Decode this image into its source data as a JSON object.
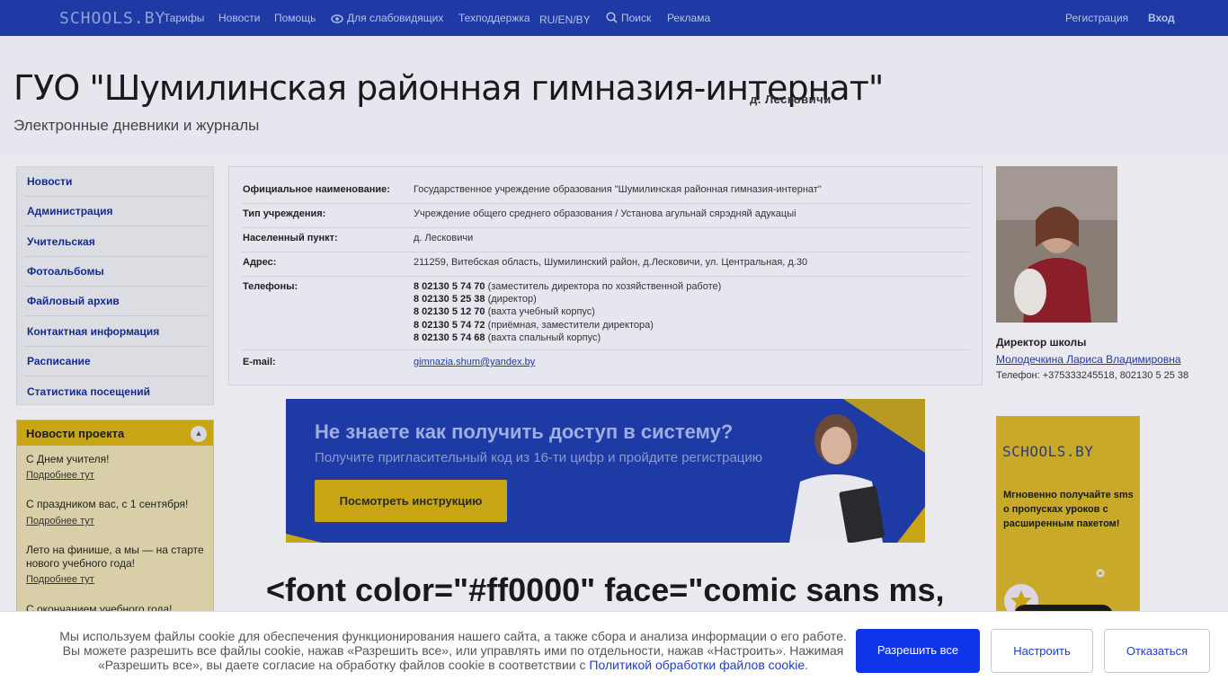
{
  "topbar": {
    "logo": "SCHOOLS.BY",
    "nav": [
      "Тарифы",
      "Новости",
      "Помощь",
      "Для слабовидящих",
      "Техподдержка",
      "RU/EN/BY",
      "Поиск",
      "Реклама"
    ],
    "register": "Регистрация",
    "login": "Вход"
  },
  "header": {
    "title": "ГУО \"Шумилинская районная гимназия-интернат\"",
    "location": "д. Лесковичи",
    "subtitle": "Электронные дневники и журналы"
  },
  "menu": [
    "Новости",
    "Администрация",
    "Учительская",
    "Фотоальбомы",
    "Файловый архив",
    "Контактная информация",
    "Расписание",
    "Статистика посещений"
  ],
  "project_news": {
    "title": "Новости проекта",
    "items": [
      {
        "title": "С Днем учителя!",
        "link": "Подробнее тут"
      },
      {
        "title": "С праздником вас, с 1 сентября!",
        "link": "Подробнее тут"
      },
      {
        "title": "Лето на финише, а мы — на старте нового учебного года!",
        "link": "Подробнее тут"
      },
      {
        "title": "С окончанием учебного года!",
        "link": ""
      }
    ]
  },
  "info": {
    "official_name_label": "Официальное наименование:",
    "official_name": "Государственное учреждение образования \"Шумилинская районная гимназия-интернат\"",
    "type_label": "Тип учреждения:",
    "type": "Учреждение общего среднего образования / Установа агульнай сярэдняй адукацыі",
    "locality_label": "Населенный пункт:",
    "locality": "д. Лесковичи",
    "address_label": "Адрес:",
    "address": "211259, Витебская область, Шумилинский район, д.Лесковичи, ул. Центральная, д.30",
    "phones_label": "Телефоны:",
    "phones": [
      {
        "number": "8 02130 5 74 70",
        "note": "(заместитель директора по хозяйственной работе)"
      },
      {
        "number": "8 02130 5 25 38",
        "note": "(директор)"
      },
      {
        "number": "8 02130 5 12 70",
        "note": "(вахта учебный корпус)"
      },
      {
        "number": "8 02130 5 74 72",
        "note": "(приёмная, заместители директора)"
      },
      {
        "number": "8 02130 5 74 68",
        "note": "(вахта спальный корпус)"
      }
    ],
    "email_label": "E-mail:",
    "email": "gimnazia.shum@yandex.by"
  },
  "director": {
    "title": "Директор школы",
    "name": "Молодечкина Лариса Владимировна",
    "phone": "Телефон: +375333245518, 802130 5 25 38"
  },
  "banner": {
    "title": "Не знаете как получить доступ в систему?",
    "subtitle": "Получите пригласительный код из 16-ти цифр и пройдите регистрацию",
    "button": "Посмотреть инструкцию"
  },
  "ad": {
    "logo": "SCHOOLS.BY",
    "text": "Мгновенно получайте sms о пропусках уроков с расширенным пакетом!"
  },
  "main_heading": "<font color=\"#ff0000\" face=\"comic sans ms,",
  "cookie": {
    "text": "Мы используем файлы cookie для обеспечения функционирования нашего сайта, а также сбора и анализа информации о его работе. Вы можете разрешить все файлы cookie, нажав «Разрешить все», или управлять ими по отдельности, нажав «Настроить». Нажимая «Разрешить все», вы даете согласие на обработку файлов cookie в соответствии с",
    "link": "Политикой обработки файлов cookie",
    "tail": ".",
    "accept": "Разрешить все",
    "settings": "Настроить",
    "reject": "Отказаться"
  },
  "colors": {
    "brand_blue": "#1e3aa4",
    "accent_gold": "#c7a514",
    "primary_button": "#1034e8"
  }
}
